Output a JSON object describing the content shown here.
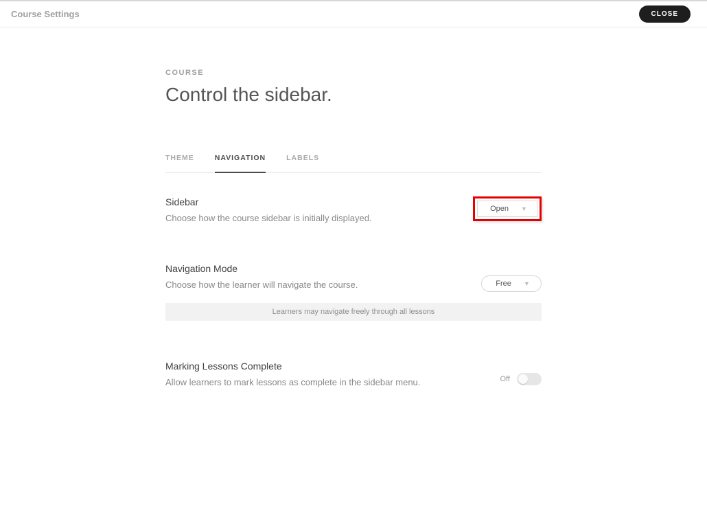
{
  "header": {
    "title": "Course Settings",
    "close_label": "CLOSE"
  },
  "hero": {
    "eyebrow": "COURSE",
    "heading": "Control the sidebar."
  },
  "tabs": {
    "theme": "THEME",
    "navigation": "NAVIGATION",
    "labels": "LABELS"
  },
  "settings": {
    "sidebar": {
      "title": "Sidebar",
      "desc": "Choose how the course sidebar is initially displayed.",
      "value": "Open"
    },
    "navigation_mode": {
      "title": "Navigation Mode",
      "desc": "Choose how the learner will navigate the course.",
      "value": "Free",
      "help": "Learners may navigate freely through all lessons"
    },
    "marking": {
      "title": "Marking Lessons Complete",
      "desc": "Allow learners to mark lessons as complete in the sidebar menu.",
      "state_label": "Off"
    }
  }
}
